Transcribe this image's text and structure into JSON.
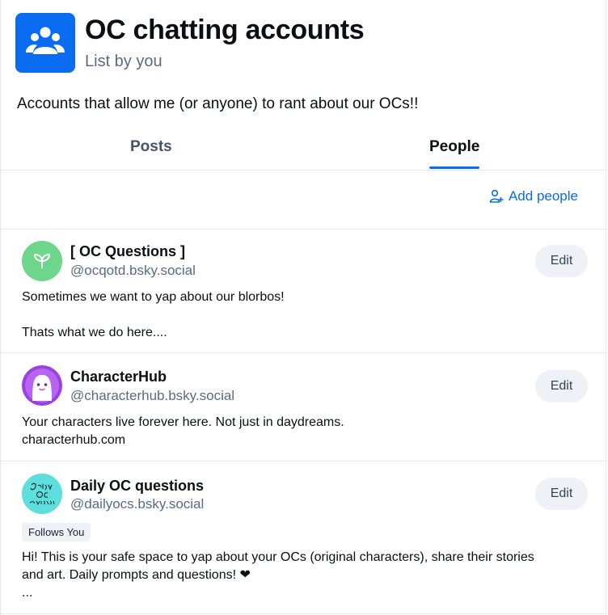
{
  "list": {
    "title": "OC chatting accounts",
    "subtitle": "List by you",
    "description": "Accounts that allow me (or anyone) to rant about our OCs!!",
    "avatar_icon": "users-group-icon",
    "accent": "#0a6cf0"
  },
  "tabs": [
    {
      "label": "Posts",
      "active": false
    },
    {
      "label": "People",
      "active": true
    }
  ],
  "actions": {
    "add_people": "Add people"
  },
  "people": [
    {
      "name": "[ OC Questions ]",
      "handle": "@ocqotd.bsky.social",
      "edit_label": "Edit",
      "bio": "Sometimes we want to yap about our blorbos!\n\nThats what we do here....",
      "avatar_icon": "sprout-icon"
    },
    {
      "name": "CharacterHub",
      "handle": "@characterhub.bsky.social",
      "edit_label": "Edit",
      "bio": "Your characters live forever here. Not just in daydreams.\ncharacterhub.com",
      "avatar_icon": "ghost-character-icon"
    },
    {
      "name": "Daily OC questions",
      "handle": "@dailyocs.bsky.social",
      "edit_label": "Edit",
      "badge": "Follows You",
      "bio": "Hi! This is your safe space to yap about your OCs (original characters), share their stories\nand art. Daily prompts and questions! ❤\n...",
      "avatar_text": "Daily OC questions"
    }
  ]
}
